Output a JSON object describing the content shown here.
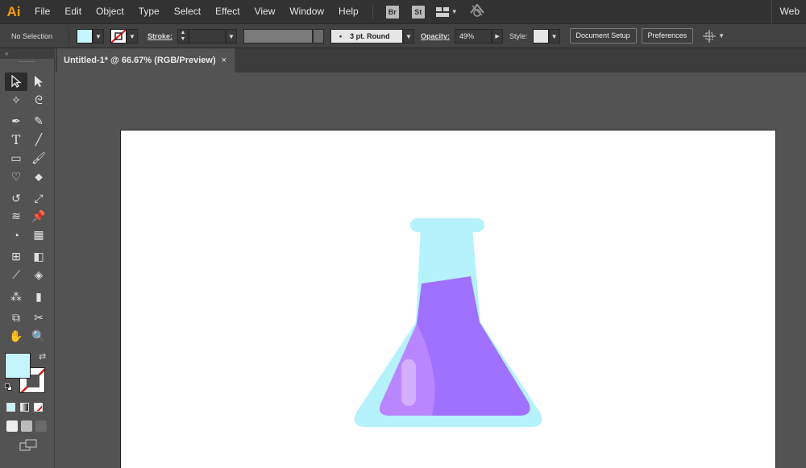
{
  "app": {
    "logo": "Ai",
    "workspace": "Web"
  },
  "menu": {
    "items": [
      "File",
      "Edit",
      "Object",
      "Type",
      "Select",
      "Effect",
      "View",
      "Window",
      "Help"
    ]
  },
  "bridge": {
    "br": "Br",
    "st": "St"
  },
  "control": {
    "selection": "No Selection",
    "stroke_label": "Stroke:",
    "brush": "3 pt. Round",
    "opacity_label": "Opacity:",
    "opacity_value": "49%",
    "style_label": "Style:",
    "document_setup": "Document Setup",
    "preferences": "Preferences"
  },
  "document": {
    "tab_title": "Untitled-1* @ 66.67% (RGB/Preview)",
    "close_glyph": "×"
  },
  "colors": {
    "fill": "#c4f4fc",
    "flask_glass": "#b5f2fc",
    "flask_liquid": "#a070ff",
    "liquid_highlight": "#c08cff",
    "menubar": "#323232",
    "logo_orange": "#ff9a00"
  },
  "tools": [
    "selection-tool",
    "direct-selection-tool",
    "magic-wand-tool",
    "lasso-tool",
    "pen-tool",
    "curvature-tool",
    "type-tool",
    "line-segment-tool",
    "rectangle-tool",
    "paintbrush-tool",
    "shaper-tool",
    "eraser-tool",
    "rotate-tool",
    "scale-tool",
    "width-tool",
    "puppet-warp-tool",
    "shape-builder-tool",
    "perspective-grid-tool",
    "mesh-tool",
    "gradient-tool",
    "eyedropper-tool",
    "blend-tool",
    "symbol-sprayer-tool",
    "column-graph-tool",
    "artboard-tool",
    "slice-tool",
    "hand-tool",
    "zoom-tool"
  ]
}
